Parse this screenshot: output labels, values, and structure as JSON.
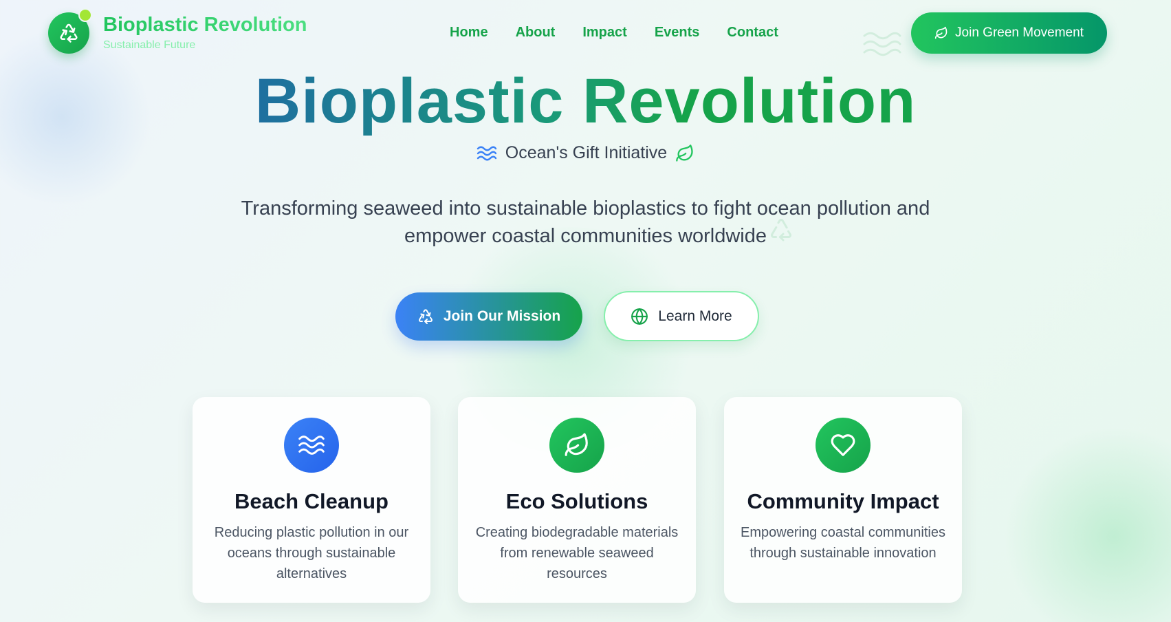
{
  "brand": {
    "name": "Bioplastic Revolution",
    "tagline": "Sustainable Future",
    "logo_icon": "recycle-icon"
  },
  "nav": {
    "items": [
      "Home",
      "About",
      "Impact",
      "Events",
      "Contact"
    ],
    "cta_label": "Join Green Movement",
    "cta_icon": "leaf-icon"
  },
  "hero": {
    "title": "Bioplastic Revolution",
    "subtitle": "Ocean's Gift Initiative",
    "description": "Transforming seaweed into sustainable bioplastics to fight ocean pollution and empower coastal communities worldwide",
    "primary_button": "Join Our Mission",
    "secondary_button": "Learn More"
  },
  "cards": [
    {
      "icon": "waves-icon",
      "title": "Beach Cleanup",
      "text": "Reducing plastic pollution in our oceans through sustainable alternatives"
    },
    {
      "icon": "leaf-icon",
      "title": "Eco Solutions",
      "text": "Creating biodegradable materials from renewable seaweed resources"
    },
    {
      "icon": "heart-icon",
      "title": "Community Impact",
      "text": "Empowering coastal communities through sustainable innovation"
    }
  ],
  "colors": {
    "accent_green": "#16a34a",
    "accent_blue": "#3b82f6",
    "text_dark": "#111827"
  }
}
